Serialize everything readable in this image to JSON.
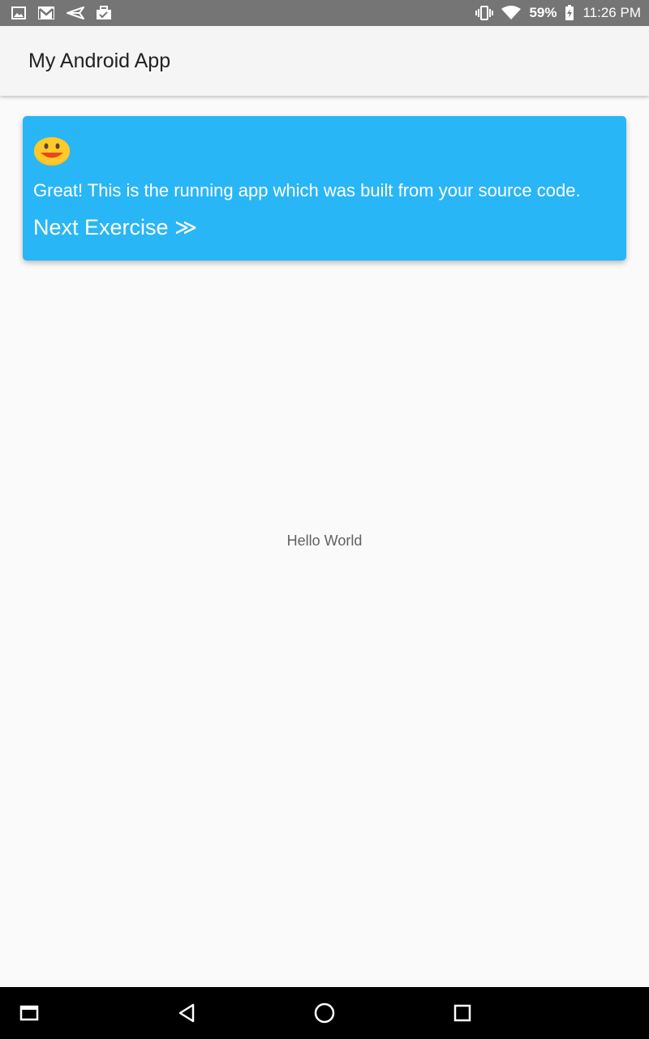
{
  "status_bar": {
    "left_icons": [
      "gallery-icon",
      "gmail-icon",
      "send-icon",
      "briefcase-icon"
    ],
    "right_icons": [
      "vibrate-icon",
      "wifi-icon",
      "battery-icon"
    ],
    "battery_percent": "59%",
    "time": "11:26 PM"
  },
  "app_bar": {
    "title": "My Android App"
  },
  "hint_card": {
    "emoji": "smiling-face-icon",
    "message": "Great! This is the running app which was built from your source code.",
    "next_label": "Next Exercise ≫",
    "background": "#29b6f6"
  },
  "main": {
    "text": "Hello World"
  },
  "nav_bar": {
    "buttons": [
      "menu-icon",
      "back-icon",
      "home-icon",
      "recents-icon"
    ]
  }
}
